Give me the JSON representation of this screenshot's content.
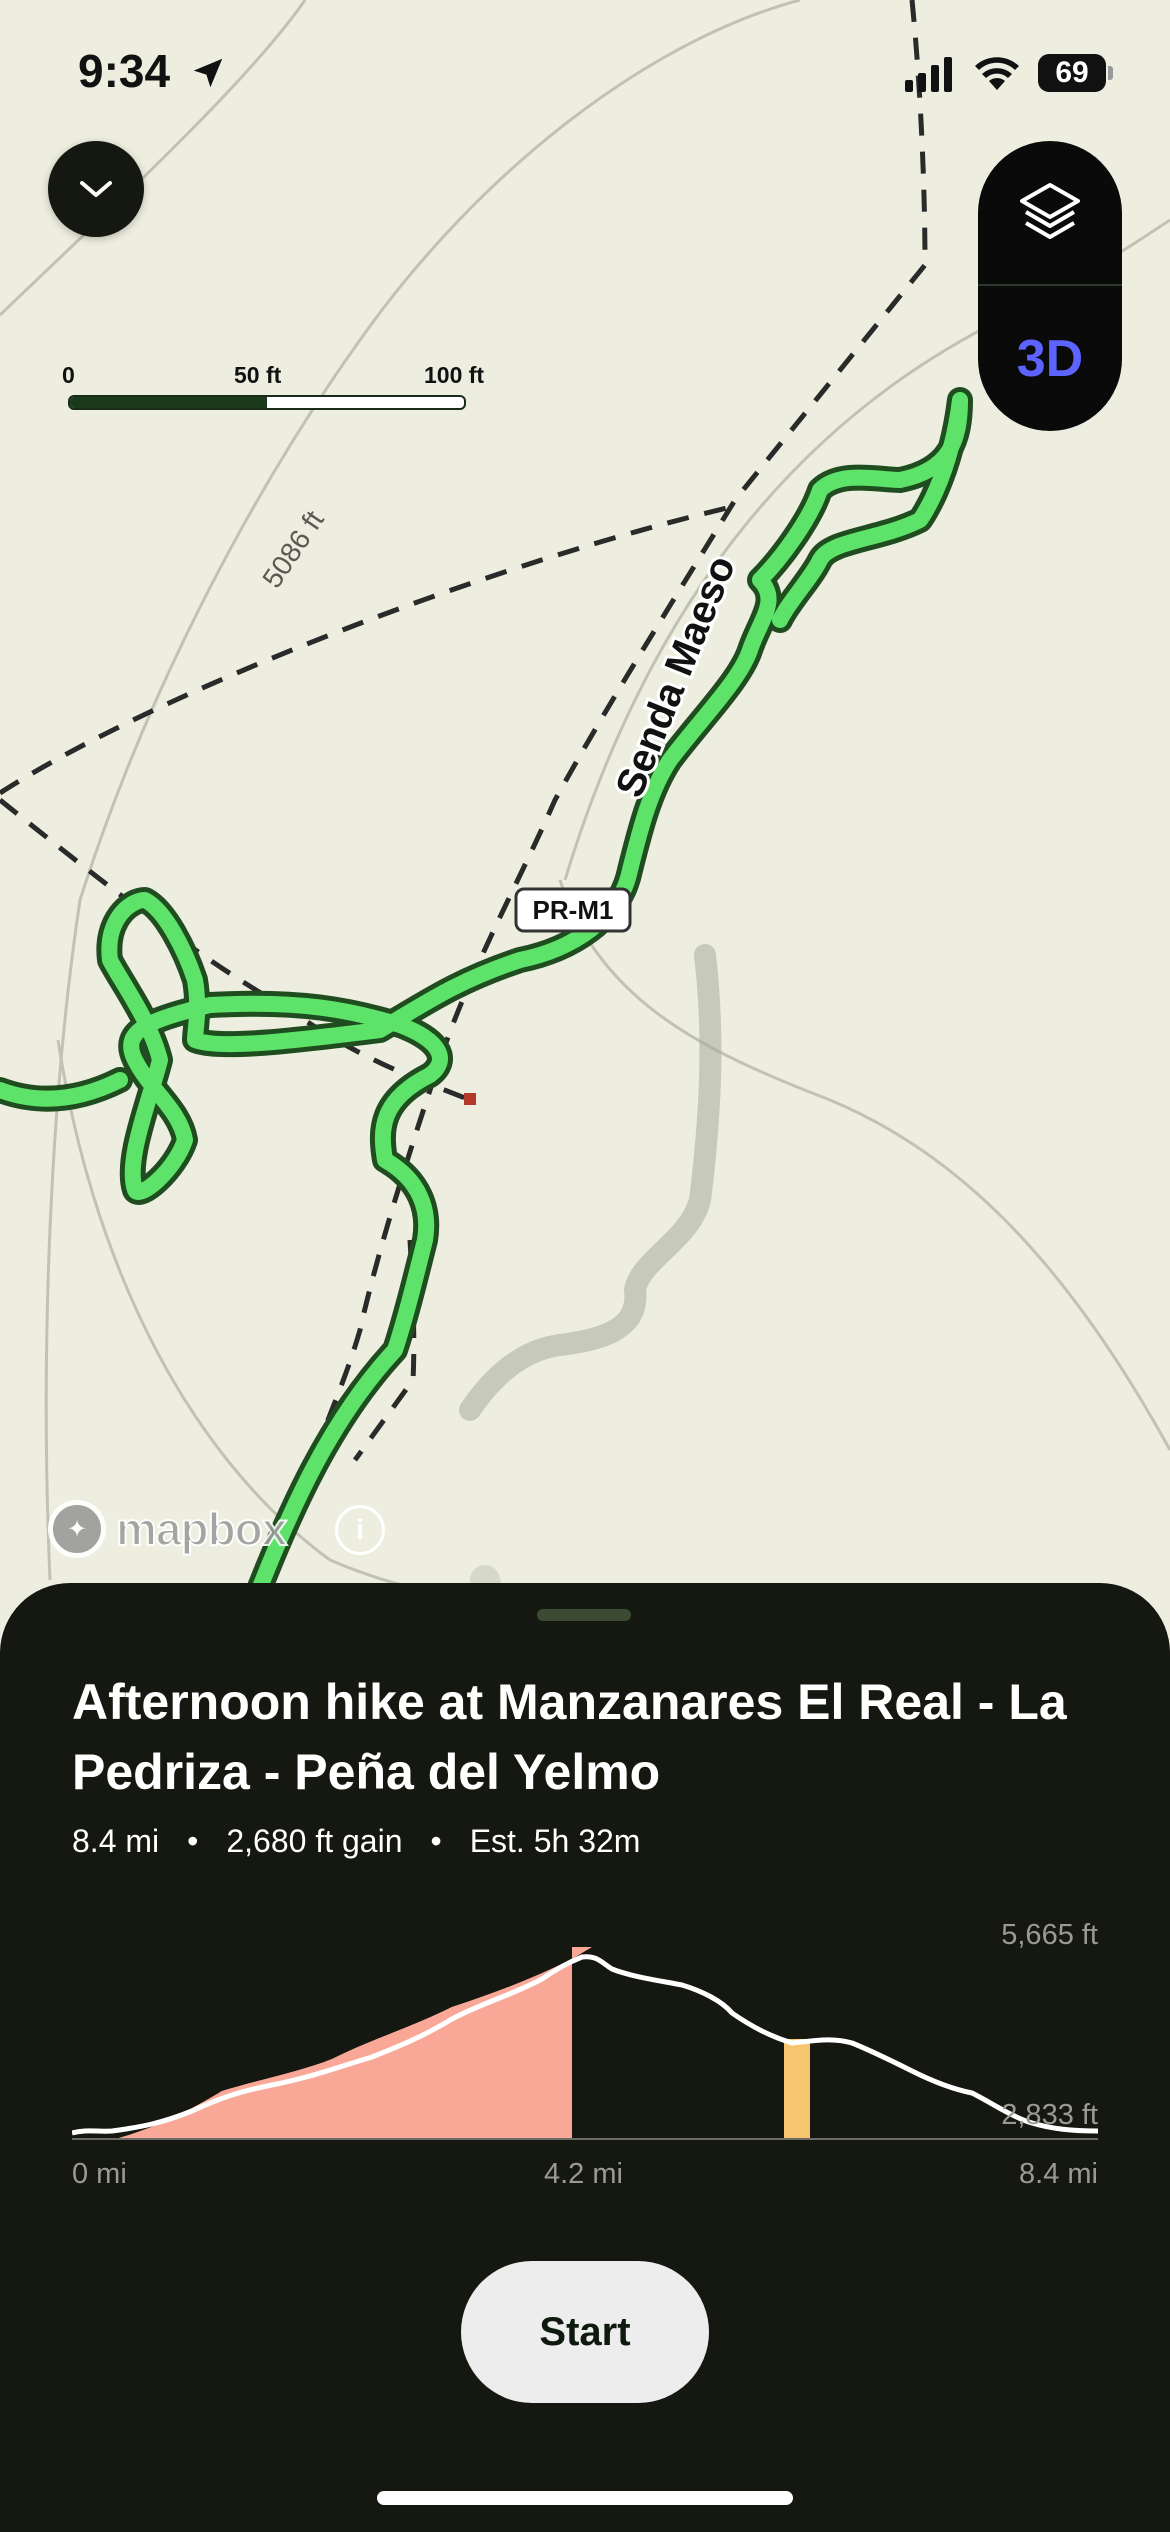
{
  "status_bar": {
    "time": "9:34",
    "battery": "69"
  },
  "map": {
    "trail_name_label": "Senda Maeso",
    "route_badge": "PR-M1",
    "contour_label": "5086 ft",
    "controls": {
      "three_d_label": "3D"
    },
    "scale": {
      "labels": [
        "0",
        "50 ft",
        "100 ft"
      ]
    },
    "attribution": "mapbox",
    "info_icon": "i",
    "colors": {
      "trail": "#57e065",
      "trail_outline": "#1f4d1f",
      "background": "#eeeee0"
    }
  },
  "sheet": {
    "title": "Afternoon hike at Manzanares El Real - La Pedriza - Peña del Yelmo",
    "stats": {
      "distance": "8.4 mi",
      "gain": "2,680 ft gain",
      "estimate": "Est. 5h 32m",
      "separator": "•"
    },
    "elevation": {
      "max_label": "5,665 ft",
      "min_label": "2,833 ft",
      "x_labels": [
        "0 mi",
        "4.2 mi",
        "8.4 mi"
      ],
      "colors": {
        "climb": "#f9a898",
        "highlight": "#f7c470",
        "line": "#ffffff"
      }
    },
    "start_button": "Start"
  }
}
